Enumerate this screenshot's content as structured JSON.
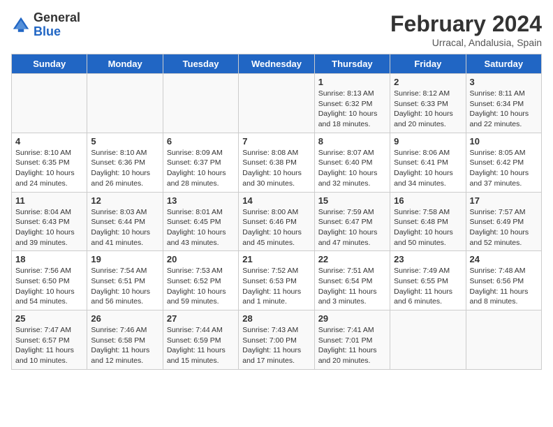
{
  "header": {
    "logo_general": "General",
    "logo_blue": "Blue",
    "month_title": "February 2024",
    "location": "Urracal, Andalusia, Spain"
  },
  "weekdays": [
    "Sunday",
    "Monday",
    "Tuesday",
    "Wednesday",
    "Thursday",
    "Friday",
    "Saturday"
  ],
  "weeks": [
    [
      {
        "day": "",
        "info": ""
      },
      {
        "day": "",
        "info": ""
      },
      {
        "day": "",
        "info": ""
      },
      {
        "day": "",
        "info": ""
      },
      {
        "day": "1",
        "info": "Sunrise: 8:13 AM\nSunset: 6:32 PM\nDaylight: 10 hours and 18 minutes."
      },
      {
        "day": "2",
        "info": "Sunrise: 8:12 AM\nSunset: 6:33 PM\nDaylight: 10 hours and 20 minutes."
      },
      {
        "day": "3",
        "info": "Sunrise: 8:11 AM\nSunset: 6:34 PM\nDaylight: 10 hours and 22 minutes."
      }
    ],
    [
      {
        "day": "4",
        "info": "Sunrise: 8:10 AM\nSunset: 6:35 PM\nDaylight: 10 hours and 24 minutes."
      },
      {
        "day": "5",
        "info": "Sunrise: 8:10 AM\nSunset: 6:36 PM\nDaylight: 10 hours and 26 minutes."
      },
      {
        "day": "6",
        "info": "Sunrise: 8:09 AM\nSunset: 6:37 PM\nDaylight: 10 hours and 28 minutes."
      },
      {
        "day": "7",
        "info": "Sunrise: 8:08 AM\nSunset: 6:38 PM\nDaylight: 10 hours and 30 minutes."
      },
      {
        "day": "8",
        "info": "Sunrise: 8:07 AM\nSunset: 6:40 PM\nDaylight: 10 hours and 32 minutes."
      },
      {
        "day": "9",
        "info": "Sunrise: 8:06 AM\nSunset: 6:41 PM\nDaylight: 10 hours and 34 minutes."
      },
      {
        "day": "10",
        "info": "Sunrise: 8:05 AM\nSunset: 6:42 PM\nDaylight: 10 hours and 37 minutes."
      }
    ],
    [
      {
        "day": "11",
        "info": "Sunrise: 8:04 AM\nSunset: 6:43 PM\nDaylight: 10 hours and 39 minutes."
      },
      {
        "day": "12",
        "info": "Sunrise: 8:03 AM\nSunset: 6:44 PM\nDaylight: 10 hours and 41 minutes."
      },
      {
        "day": "13",
        "info": "Sunrise: 8:01 AM\nSunset: 6:45 PM\nDaylight: 10 hours and 43 minutes."
      },
      {
        "day": "14",
        "info": "Sunrise: 8:00 AM\nSunset: 6:46 PM\nDaylight: 10 hours and 45 minutes."
      },
      {
        "day": "15",
        "info": "Sunrise: 7:59 AM\nSunset: 6:47 PM\nDaylight: 10 hours and 47 minutes."
      },
      {
        "day": "16",
        "info": "Sunrise: 7:58 AM\nSunset: 6:48 PM\nDaylight: 10 hours and 50 minutes."
      },
      {
        "day": "17",
        "info": "Sunrise: 7:57 AM\nSunset: 6:49 PM\nDaylight: 10 hours and 52 minutes."
      }
    ],
    [
      {
        "day": "18",
        "info": "Sunrise: 7:56 AM\nSunset: 6:50 PM\nDaylight: 10 hours and 54 minutes."
      },
      {
        "day": "19",
        "info": "Sunrise: 7:54 AM\nSunset: 6:51 PM\nDaylight: 10 hours and 56 minutes."
      },
      {
        "day": "20",
        "info": "Sunrise: 7:53 AM\nSunset: 6:52 PM\nDaylight: 10 hours and 59 minutes."
      },
      {
        "day": "21",
        "info": "Sunrise: 7:52 AM\nSunset: 6:53 PM\nDaylight: 11 hours and 1 minute."
      },
      {
        "day": "22",
        "info": "Sunrise: 7:51 AM\nSunset: 6:54 PM\nDaylight: 11 hours and 3 minutes."
      },
      {
        "day": "23",
        "info": "Sunrise: 7:49 AM\nSunset: 6:55 PM\nDaylight: 11 hours and 6 minutes."
      },
      {
        "day": "24",
        "info": "Sunrise: 7:48 AM\nSunset: 6:56 PM\nDaylight: 11 hours and 8 minutes."
      }
    ],
    [
      {
        "day": "25",
        "info": "Sunrise: 7:47 AM\nSunset: 6:57 PM\nDaylight: 11 hours and 10 minutes."
      },
      {
        "day": "26",
        "info": "Sunrise: 7:46 AM\nSunset: 6:58 PM\nDaylight: 11 hours and 12 minutes."
      },
      {
        "day": "27",
        "info": "Sunrise: 7:44 AM\nSunset: 6:59 PM\nDaylight: 11 hours and 15 minutes."
      },
      {
        "day": "28",
        "info": "Sunrise: 7:43 AM\nSunset: 7:00 PM\nDaylight: 11 hours and 17 minutes."
      },
      {
        "day": "29",
        "info": "Sunrise: 7:41 AM\nSunset: 7:01 PM\nDaylight: 11 hours and 20 minutes."
      },
      {
        "day": "",
        "info": ""
      },
      {
        "day": "",
        "info": ""
      }
    ]
  ]
}
